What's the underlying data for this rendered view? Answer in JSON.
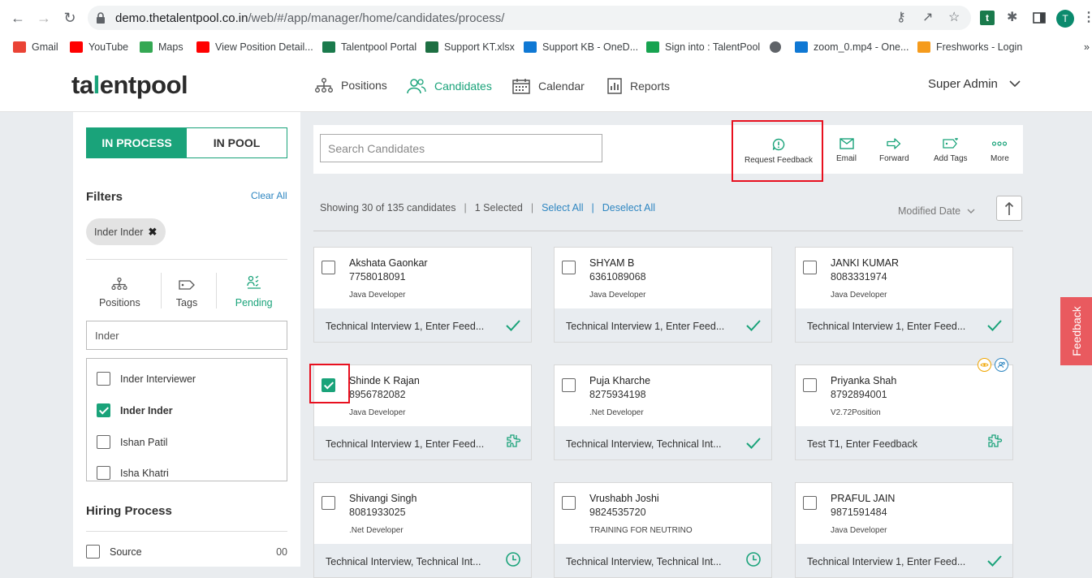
{
  "browser": {
    "url_main": "demo.thetalentpool.co.in",
    "url_path": "/web/#/app/manager/home/candidates/process/",
    "profile_initial": "T",
    "bookmarks": [
      {
        "label": "Gmail",
        "color": "#ea4335"
      },
      {
        "label": "YouTube",
        "color": "#ff0000"
      },
      {
        "label": "Maps",
        "color": "#34a853"
      },
      {
        "label": "View Position Detail...",
        "color": "#ff0000"
      },
      {
        "label": "Talentpool Portal",
        "color": "#1a7a4c"
      },
      {
        "label": "Support KT.xlsx",
        "color": "#1d6f42"
      },
      {
        "label": "Support KB - OneD...",
        "color": "#0f78d4"
      },
      {
        "label": "Sign into : TalentPool",
        "color": "#17a350"
      },
      {
        "label": "",
        "color": "#5f6368"
      },
      {
        "label": "zoom_0.mp4 - One...",
        "color": "#0f78d4"
      },
      {
        "label": "Freshworks - Login",
        "color": "#f59b1c"
      }
    ]
  },
  "app": {
    "logo_pre": "ta",
    "logo_accent": "l",
    "logo_post": "entpool",
    "nav": {
      "positions": "Positions",
      "candidates": "Candidates",
      "calendar": "Calendar",
      "reports": "Reports"
    },
    "user": "Super Admin"
  },
  "left": {
    "tab_in_process": "IN PROCESS",
    "tab_in_pool": "IN POOL",
    "filters_title": "Filters",
    "clear_all": "Clear All",
    "chip": "Inder Inder",
    "ftabs": {
      "positions": "Positions",
      "tags": "Tags",
      "pending": "Pending"
    },
    "filter_input": "Inder",
    "filter_items": [
      {
        "label": "Inder Interviewer",
        "checked": false
      },
      {
        "label": "Inder Inder",
        "checked": true
      },
      {
        "label": "Ishan Patil",
        "checked": false
      },
      {
        "label": "Isha Khatri",
        "checked": false
      }
    ],
    "hiring_title": "Hiring Process",
    "source_label": "Source",
    "source_count": "00"
  },
  "toolbar": {
    "search_placeholder": "Search Candidates",
    "request_feedback": "Request Feedback",
    "email": "Email",
    "forward": "Forward",
    "add_tags": "Add Tags",
    "more": "More"
  },
  "listing": {
    "showing": "Showing 30 of 135 candidates",
    "selected": "1 Selected",
    "select_all": "Select All",
    "deselect_all": "Deselect All",
    "sort_by": "Modified Date"
  },
  "colors": {
    "accent": "#1aa37a",
    "highlight": "#e8101f",
    "feedback_tab": "#e95a5f",
    "link": "#2e86c1"
  },
  "candidates": [
    {
      "name": "Akshata Gaonkar",
      "phone": "7758018091",
      "position": "Java Developer",
      "stage": "Technical Interview 1, Enter Feed...",
      "status": "check-icon",
      "checked": false
    },
    {
      "name": "SHYAM B",
      "phone": "6361089068",
      "position": "Java Developer",
      "stage": "Technical Interview 1, Enter Feed...",
      "status": "check-icon",
      "checked": false
    },
    {
      "name": "JANKI KUMAR",
      "phone": "8083331974",
      "position": "Java Developer",
      "stage": "Technical Interview 1, Enter Feed...",
      "status": "check-icon",
      "checked": false
    },
    {
      "name": "Shinde K Rajan",
      "phone": "8956782082",
      "position": "Java Developer",
      "stage": "Technical Interview 1, Enter Feed...",
      "status": "puzzle-icon",
      "checked": true
    },
    {
      "name": "Puja Kharche",
      "phone": "8275934198",
      "position": ".Net Developer",
      "stage": "Technical Interview, Technical Int...",
      "status": "check-icon",
      "checked": false
    },
    {
      "name": "Priyanka Shah",
      "phone": "8792894001",
      "position": "V2.72Position",
      "stage": "Test T1, Enter Feedback",
      "status": "puzzle-icon",
      "checked": false
    },
    {
      "name": "Shivangi Singh",
      "phone": "8081933025",
      "position": ".Net Developer",
      "stage": "Technical Interview, Technical Int...",
      "status": "clock-icon",
      "checked": false
    },
    {
      "name": "Vrushabh Joshi",
      "phone": "9824535720",
      "position": "TRAINING FOR NEUTRINO",
      "stage": "Technical Interview, Technical Int...",
      "status": "clock-icon",
      "checked": false
    },
    {
      "name": "PRAFUL JAIN",
      "phone": "9871591484",
      "position": "Java Developer",
      "stage": "Technical Interview 1, Enter Feed...",
      "status": "check-icon",
      "checked": false
    }
  ],
  "feedback_tab": "Feedback"
}
